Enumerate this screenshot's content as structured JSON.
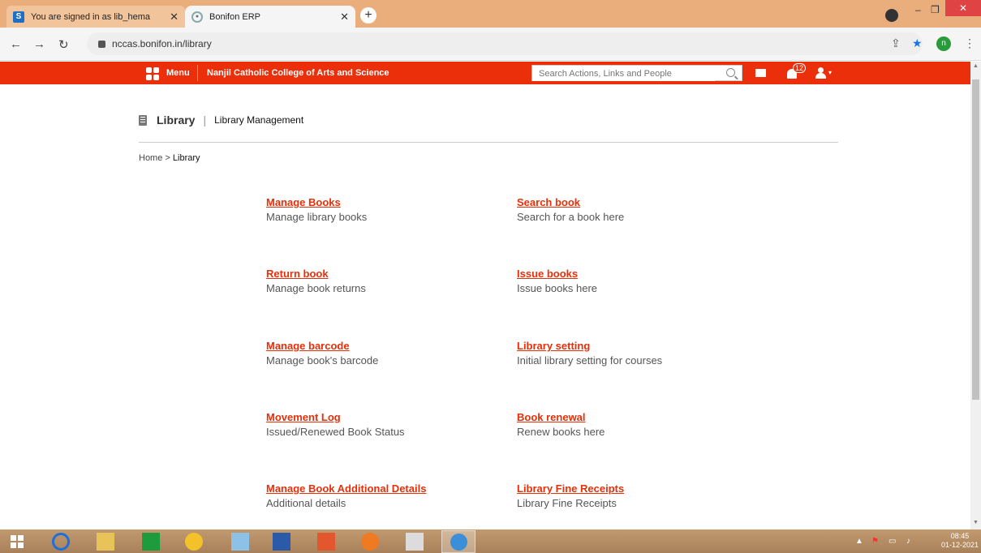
{
  "browser": {
    "tabs": [
      {
        "label": "You are signed in as lib_hema",
        "favicon": "S"
      },
      {
        "label": "Bonifon ERP"
      }
    ],
    "new_tab": "+",
    "url": "nccas.bonifon.in/library",
    "account_initial": "n"
  },
  "header": {
    "menu_label": "Menu",
    "college_name": "Nanjil Catholic College of Arts and Science",
    "search_placeholder": "Search Actions, Links and People",
    "notification_count": "12",
    "accent_color": "#ea2f0a"
  },
  "page": {
    "title": "Library",
    "separator": "|",
    "subtitle": "Library Management",
    "breadcrumb": {
      "home": "Home",
      "sep": ">",
      "current": "Library"
    }
  },
  "items": [
    {
      "link": "Manage Books",
      "desc": "Manage library books"
    },
    {
      "link": "Search book",
      "desc": "Search for a book here"
    },
    {
      "link": "Return book",
      "desc": "Manage book returns"
    },
    {
      "link": "Issue books",
      "desc": "Issue books here"
    },
    {
      "link": "Manage barcode",
      "desc": "Manage book's barcode"
    },
    {
      "link": "Library setting",
      "desc": "Initial library setting for courses"
    },
    {
      "link": "Movement Log",
      "desc": "Issued/Renewed Book Status"
    },
    {
      "link": "Book renewal",
      "desc": "Renew books here"
    },
    {
      "link": "Manage Book Additional Details",
      "desc": "Additional details"
    },
    {
      "link": "Library Fine Receipts",
      "desc": "Library Fine Receipts"
    }
  ],
  "taskbar": {
    "time": "08:45",
    "date": "01-12-2021"
  }
}
